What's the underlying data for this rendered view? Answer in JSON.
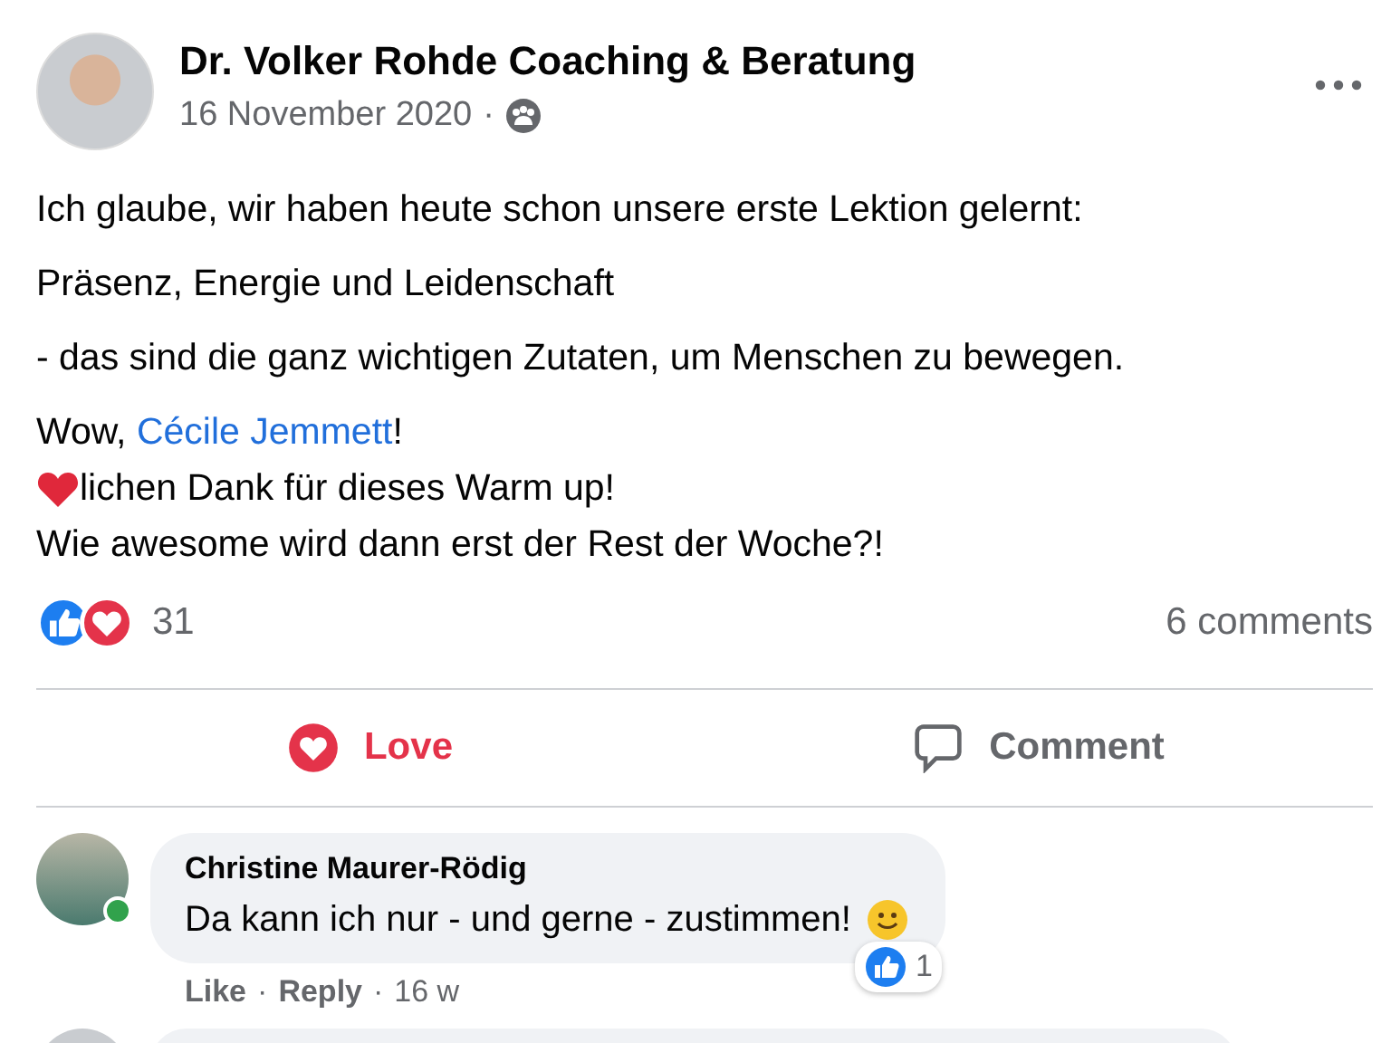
{
  "post": {
    "author": "Dr. Volker Rohde Coaching & Beratung",
    "date": "16 November 2020",
    "separator": "·",
    "paragraphs": [
      {
        "lines": [
          {
            "kind": "text",
            "text": "Ich glaube, wir haben heute schon unsere erste Lektion gelernt:"
          }
        ]
      },
      {
        "lines": [
          {
            "kind": "text",
            "text": "Präsenz, Energie und Leidenschaft"
          }
        ]
      },
      {
        "lines": [
          {
            "kind": "text",
            "text": "- das sind die ganz wichtigen Zutaten, um Menschen zu bewegen."
          }
        ]
      },
      {
        "lines": [
          {
            "kind": "mention",
            "before": "Wow, ",
            "link": "Cécile Jemmett",
            "after": "!"
          },
          {
            "kind": "heart",
            "text": "lichen Dank für dieses Warm up!"
          },
          {
            "kind": "text",
            "text": "Wie awesome wird dann erst der Rest der Woche?!"
          }
        ]
      }
    ]
  },
  "reactions": {
    "count": "31",
    "comments": "6 comments"
  },
  "actions": [
    {
      "kind": "love",
      "label": "Love",
      "active": true
    },
    {
      "kind": "comment",
      "label": "Comment",
      "active": false
    }
  ],
  "comments": [
    {
      "author": "Christine Maurer-Rödig",
      "online": true,
      "text": "Da kann ich nur - und gerne - zustimmen!",
      "like_count": "1",
      "links": [
        "Like",
        "Reply"
      ],
      "separator": "·",
      "time": "16 w"
    }
  ]
}
